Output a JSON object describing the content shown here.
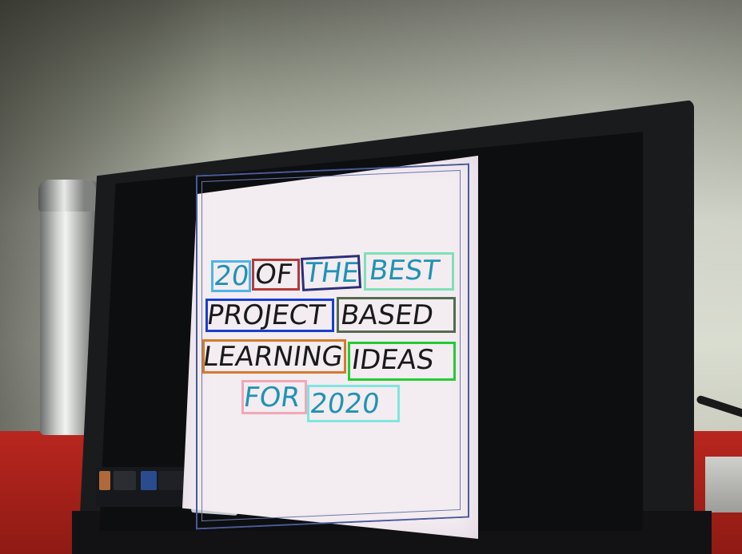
{
  "scene": {
    "description_free": true
  },
  "slide": {
    "lines": [
      [
        "20",
        "OF",
        "THE",
        "BEST"
      ],
      [
        "PROJECT",
        "BASED"
      ],
      [
        "LEARNING",
        "IDEAS"
      ],
      [
        "FOR",
        "2020"
      ]
    ],
    "words": {
      "w_20": "20",
      "w_of": "OF",
      "w_the": "THE",
      "w_best": "BEST",
      "w_project": "PROJECT",
      "w_based": "BASED",
      "w_learning": "LEARNING",
      "w_ideas": "IDEAS",
      "w_for": "FOR",
      "w_2020": "2020"
    },
    "colors": {
      "background": "#f3ecf0",
      "border": "#4a5a9a",
      "teal_text": "#1f93b5",
      "dark_text": "#1a1a1a"
    }
  },
  "annotation_boxes": {
    "b_20": "#4fb4e6",
    "b_of": "#b23a3a",
    "b_the": "#2a2f7a",
    "b_best": "#7fe0b8",
    "b_project": "#1a3fd0",
    "b_based": "#556b4f",
    "b_learning": "#d67a2c",
    "b_ideas": "#22cc33",
    "b_for": "#f0a8b8",
    "b_2020": "#7ee6e0"
  }
}
